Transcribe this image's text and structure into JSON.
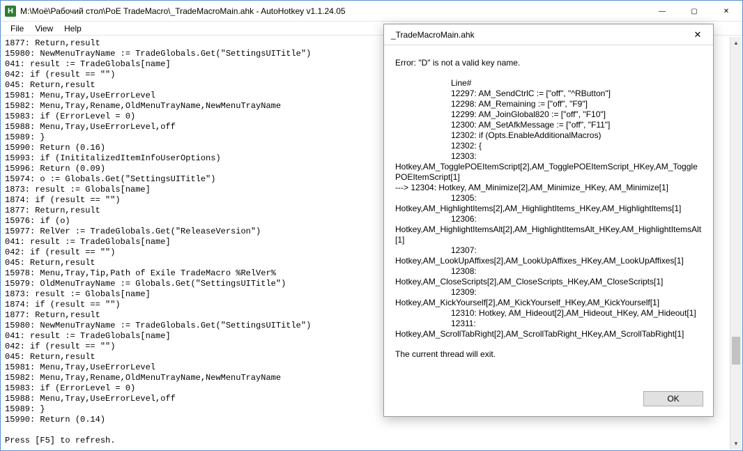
{
  "window": {
    "icon_letter": "H",
    "title": "M:\\Моё\\Рабочий стол\\PoE TradeMacro\\_TradeMacroMain.ahk - AutoHotkey v1.1.24.05",
    "min": "—",
    "max": "▢",
    "close": "✕"
  },
  "menu": {
    "file": "File",
    "view": "View",
    "help": "Help"
  },
  "code_lines": [
    "1877: Return,result",
    "15980: NewMenuTrayName := TradeGlobals.Get(\"SettingsUITitle\")",
    "041: result := TradeGlobals[name]",
    "042: if (result == \"\")",
    "045: Return,result",
    "15981: Menu,Tray,UseErrorLevel",
    "15982: Menu,Tray,Rename,OldMenuTrayName,NewMenuTrayName",
    "15983: if (ErrorLevel = 0)",
    "15988: Menu,Tray,UseErrorLevel,off",
    "15989: }",
    "15990: Return (0.16)",
    "15993: if (InititalizedItemInfoUserOptions)",
    "15996: Return (0.09)",
    "15974: o := Globals.Get(\"SettingsUITitle\")",
    "1873: result := Globals[name]",
    "1874: if (result == \"\")",
    "1877: Return,result",
    "15976: if (o)",
    "15977: RelVer := TradeGlobals.Get(\"ReleaseVersion\")",
    "041: result := TradeGlobals[name]",
    "042: if (result == \"\")",
    "045: Return,result",
    "15978: Menu,Tray,Tip,Path of Exile TradeMacro %RelVer%",
    "15979: OldMenuTrayName := Globals.Get(\"SettingsUITitle\")",
    "1873: result := Globals[name]",
    "1874: if (result == \"\")",
    "1877: Return,result",
    "15980: NewMenuTrayName := TradeGlobals.Get(\"SettingsUITitle\")",
    "041: result := TradeGlobals[name]",
    "042: if (result == \"\")",
    "045: Return,result",
    "15981: Menu,Tray,UseErrorLevel",
    "15982: Menu,Tray,Rename,OldMenuTrayName,NewMenuTrayName",
    "15983: if (ErrorLevel = 0)",
    "15988: Menu,Tray,UseErrorLevel,off",
    "15989: }",
    "15990: Return (0.14)",
    "",
    "Press [F5] to refresh."
  ],
  "dialog": {
    "title": "_TradeMacroMain.ahk",
    "close": "✕",
    "error_header": "Error:  \"D\" is not a valid key name.",
    "line_label": "Line#",
    "lines_indented": [
      "12297: AM_SendCtrlC := [\"off\", \"^RButton\"]",
      "12298: AM_Remaining := [\"off\", \"F9\"]",
      "12299: AM_JoinGlobal820 := [\"off\", \"F10\"]",
      "12300: AM_SetAfkMessage := [\"off\", \"F11\"]",
      "12302: if (Opts.EnableAdditionalMacros)",
      "12302: {",
      "12303:"
    ],
    "wrap1": "Hotkey,AM_TogglePOEItemScript[2],AM_TogglePOEItemScript_HKey,AM_TogglePOEItemScript[1]",
    "arrow_line": "--->        12304: Hotkey, AM_Minimize[2],AM_Minimize_HKey, AM_Minimize[1]",
    "ind_12305": "12305:",
    "wrap2": "Hotkey,AM_HighlightItems[2],AM_HighlightItems_HKey,AM_HighlightItems[1]",
    "ind_12306": "12306:",
    "wrap3": "Hotkey,AM_HighlightItemsAlt[2],AM_HighlightItemsAlt_HKey,AM_HighlightItemsAlt[1]",
    "ind_12307": "12307:",
    "wrap4": "Hotkey,AM_LookUpAffixes[2],AM_LookUpAffixes_HKey,AM_LookUpAffixes[1]",
    "ind_12308": "12308:",
    "wrap5": "Hotkey,AM_CloseScripts[2],AM_CloseScripts_HKey,AM_CloseScripts[1]",
    "ind_12309": "12309:",
    "wrap6": "Hotkey,AM_KickYourself[2],AM_KickYourself_HKey,AM_KickYourself[1]",
    "ind_12310": "12310: Hotkey, AM_Hideout[2],AM_Hideout_HKey, AM_Hideout[1]",
    "ind_12311": "12311:",
    "wrap7": "Hotkey,AM_ScrollTabRight[2],AM_ScrollTabRight_HKey,AM_ScrollTabRight[1]",
    "exit_msg": "The current thread will exit.",
    "ok_label": "OK"
  }
}
